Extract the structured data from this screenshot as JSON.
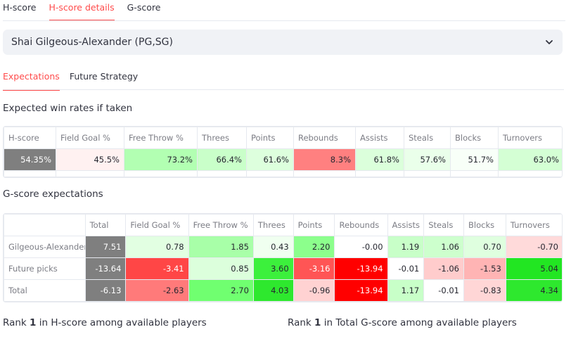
{
  "top_tabs": [
    "H-score",
    "H-score details",
    "G-score"
  ],
  "top_tabs_active": 1,
  "player_select": {
    "value": "Shai Gilgeous-Alexander (PG,SG)",
    "icon": "chevron-down-icon"
  },
  "sub_tabs": [
    "Expectations",
    "Future Strategy"
  ],
  "sub_tabs_active": 0,
  "win_rates": {
    "heading": "Expected win rates if taken",
    "columns": [
      "H-score",
      "Field Goal %",
      "Free Throw %",
      "Threes",
      "Points",
      "Rebounds",
      "Assists",
      "Steals",
      "Blocks",
      "Turnovers"
    ],
    "values": [
      "54.35%",
      "45.5%",
      "73.2%",
      "66.4%",
      "61.6%",
      "8.3%",
      "61.8%",
      "57.6%",
      "51.7%",
      "63.0%"
    ],
    "colors": [
      "#7f7f7f",
      "#fff1f1",
      "#b2ffb2",
      "#c9ffc9",
      "#ddffdd",
      "#ff8080",
      "#dbffdb",
      "#eaffea",
      "#f8fff8",
      "#d4ffd4"
    ]
  },
  "g_score": {
    "heading": "G-score expectations",
    "columns": [
      "",
      "Total",
      "Field Goal %",
      "Free Throw %",
      "Threes",
      "Points",
      "Rebounds",
      "Assists",
      "Steals",
      "Blocks",
      "Turnovers"
    ],
    "rows": [
      {
        "label": "Gilgeous-Alexander",
        "values": [
          "7.51",
          "0.78",
          "1.85",
          "0.43",
          "2.20",
          "-0.00",
          "1.19",
          "1.06",
          "0.70",
          "-0.70"
        ],
        "colors": [
          "#7f7f7f",
          "#e2ffe2",
          "#a8ffa8",
          "#f0fff0",
          "#8cff8c",
          "#ffffff",
          "#c8ffc8",
          "#cdffcd",
          "#dfffdf",
          "#ffdada"
        ]
      },
      {
        "label": "Future picks",
        "values": [
          "-13.64",
          "-3.41",
          "0.85",
          "3.60",
          "-3.16",
          "-13.94",
          "-0.01",
          "-1.06",
          "-1.53",
          "5.04"
        ],
        "colors": [
          "#7f7f7f",
          "#ff4646",
          "#dcffdc",
          "#3cf03c",
          "#ff5555",
          "#ff0000",
          "#ffffff",
          "#ffcccc",
          "#ffb4b4",
          "#22e622"
        ]
      },
      {
        "label": "Total",
        "values": [
          "-6.13",
          "-2.63",
          "2.70",
          "4.03",
          "-0.96",
          "-13.94",
          "1.17",
          "-0.01",
          "-0.83",
          "4.34"
        ],
        "colors": [
          "#7f7f7f",
          "#ff7a7a",
          "#70ff70",
          "#2ee82e",
          "#ffd2d2",
          "#ff0000",
          "#c8ffc8",
          "#ffffff",
          "#ffd6d6",
          "#2ee82e"
        ]
      }
    ]
  },
  "rank_h": {
    "prefix": "Rank ",
    "number": "1",
    "suffix": " in H-score among available players"
  },
  "rank_g": {
    "prefix": "Rank ",
    "number": "1",
    "suffix": " in Total G-score among available players"
  },
  "colors": {
    "accent": "#ff4b4b",
    "select_bg": "#f0f2f6",
    "border": "#e6e9ef"
  }
}
